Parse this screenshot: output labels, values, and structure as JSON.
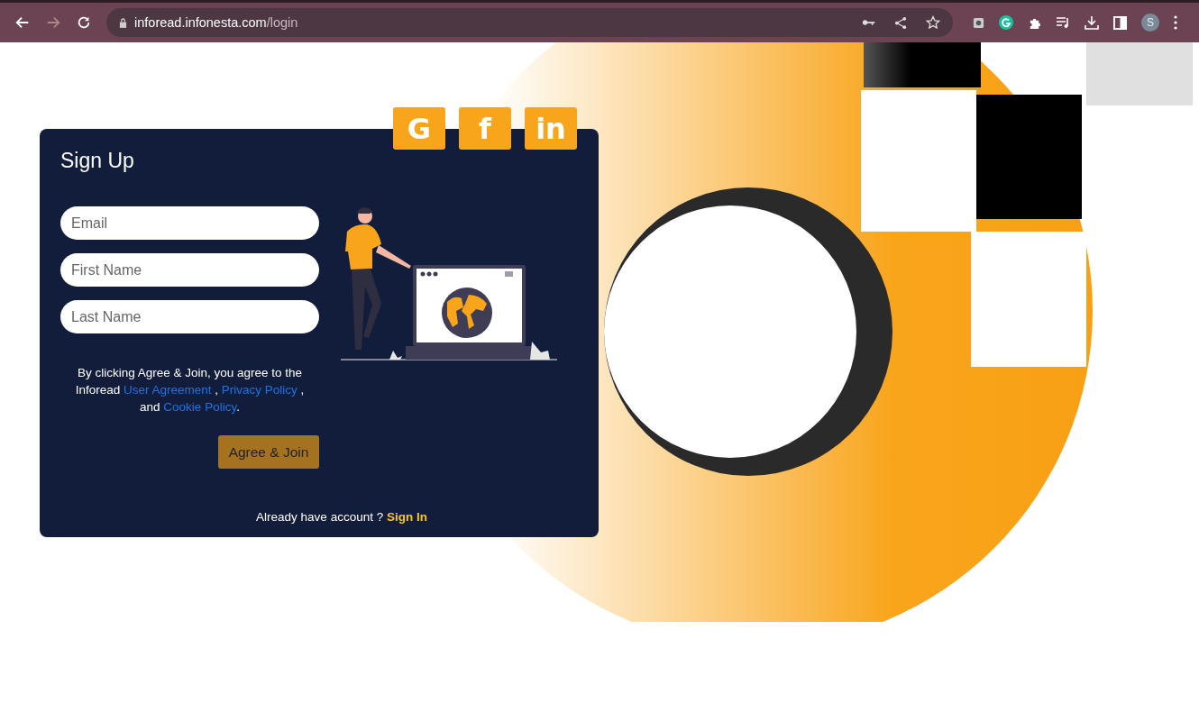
{
  "browser": {
    "url_host": "inforead.infonesta.com",
    "url_path": "/login",
    "profile_initial": "S"
  },
  "social_buttons": [
    {
      "label": "G"
    },
    {
      "label": "f"
    },
    {
      "label": "in"
    }
  ],
  "form": {
    "title": "Sign Up",
    "fields": [
      {
        "placeholder": "Email"
      },
      {
        "placeholder": "First Name"
      },
      {
        "placeholder": "Last Name"
      }
    ],
    "agreement": [
      {
        "kind": "text",
        "text": "By clicking Agree & Join, you agree to the Inforead "
      },
      {
        "kind": "link",
        "text": "User Agreement"
      },
      {
        "kind": "text",
        "text": " , "
      },
      {
        "kind": "link",
        "text": "Privacy Policy"
      },
      {
        "kind": "text",
        "text": " , and "
      },
      {
        "kind": "link",
        "text": "Cookie Policy"
      },
      {
        "kind": "text",
        "text": "."
      }
    ],
    "submit": "Agree & Join",
    "signin_prompt": "Already have account ?",
    "signin_link": "Sign In"
  }
}
